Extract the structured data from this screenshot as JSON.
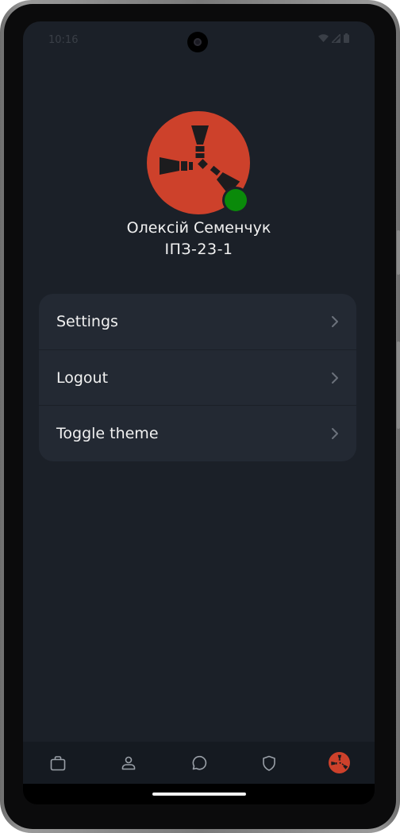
{
  "status_bar": {
    "time": "10:16",
    "icons": [
      "wifi-icon",
      "signal-icon",
      "battery-icon"
    ]
  },
  "profile": {
    "name": "Олексій Семенчук",
    "group": "ІПЗ-23-1",
    "online": true,
    "avatar_icon": "rust-logo-icon",
    "avatar_color": "#cd412b",
    "online_color": "#0a8a0a"
  },
  "menu": {
    "items": [
      {
        "label": "Settings",
        "icon": "chevron-right-icon"
      },
      {
        "label": "Logout",
        "icon": "chevron-right-icon"
      },
      {
        "label": "Toggle theme",
        "icon": "chevron-right-icon"
      }
    ]
  },
  "bottom_nav": {
    "items": [
      {
        "icon": "bag-icon"
      },
      {
        "icon": "person-icon"
      },
      {
        "icon": "chat-icon"
      },
      {
        "icon": "shield-icon"
      },
      {
        "icon": "profile-avatar-icon",
        "active": true
      }
    ]
  },
  "colors": {
    "background": "#1b2028",
    "card": "#232933",
    "nav_bar": "#151a21",
    "text": "#f1f1f1",
    "icon": "#9aa0a8"
  }
}
